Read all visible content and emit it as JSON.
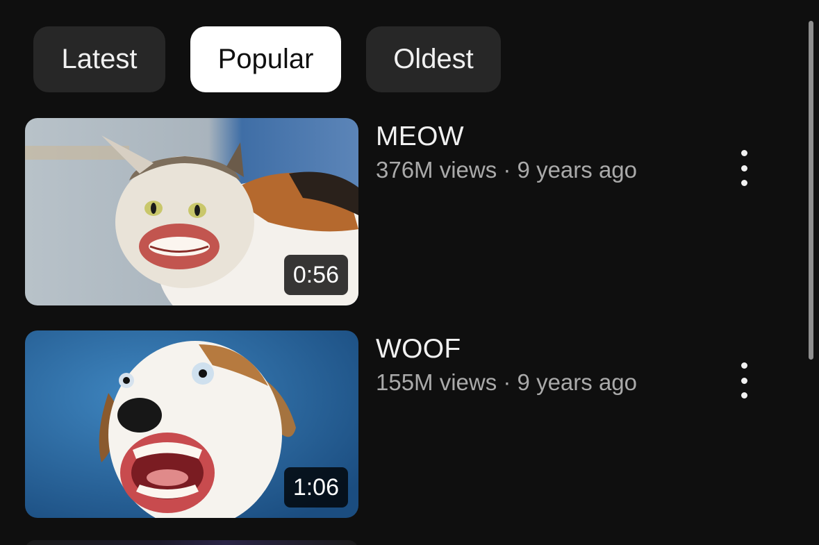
{
  "filters": {
    "latest": "Latest",
    "popular": "Popular",
    "oldest": "Oldest",
    "selected": "Popular"
  },
  "videos": [
    {
      "title": "MEOW",
      "meta": "376M views · 9 years ago",
      "duration": "0:56",
      "thumbnail_icon": "cat-with-human-mouth-thumbnail"
    },
    {
      "title": "WOOF",
      "meta": "155M views · 9 years ago",
      "duration": "1:06",
      "thumbnail_icon": "dog-with-human-mouth-thumbnail"
    }
  ],
  "colors": {
    "background": "#0f0f0f",
    "chip": "#272727",
    "chip_active": "#ffffff",
    "secondary_text": "#aaaaaa"
  }
}
